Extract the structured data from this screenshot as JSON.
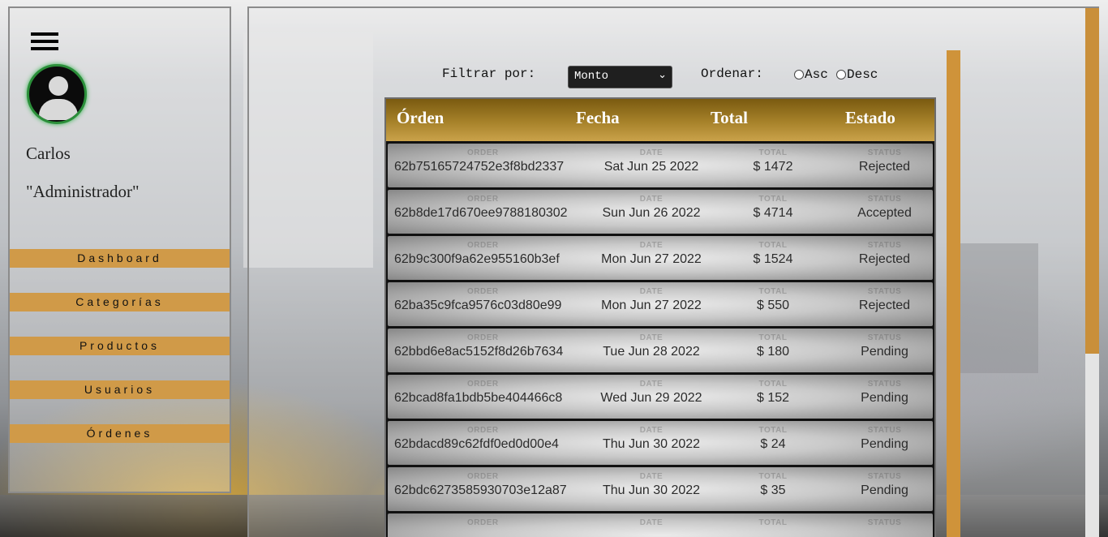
{
  "sidebar": {
    "user_name": "Carlos",
    "user_role": "\"Administrador\"",
    "nav": [
      "Dashboard",
      "Categorías",
      "Productos",
      "Usuarios",
      "Órdenes"
    ]
  },
  "filters": {
    "filter_label": "Filtrar por:",
    "filter_value": "Monto",
    "order_label": "Ordenar:",
    "asc_label": "Asc",
    "desc_label": "Desc"
  },
  "table": {
    "headers": [
      "Órden",
      "Fecha",
      "Total",
      "Estado"
    ],
    "cell_tags": [
      "ORDER",
      "DATE",
      "TOTAL",
      "STATUS"
    ],
    "rows": [
      {
        "order": "62b75165724752e3f8bd2337",
        "date": "Sat Jun 25 2022",
        "total": "$ 1472",
        "status": "Rejected"
      },
      {
        "order": "62b8de17d670ee9788180302",
        "date": "Sun Jun 26 2022",
        "total": "$ 4714",
        "status": "Accepted"
      },
      {
        "order": "62b9c300f9a62e955160b3ef",
        "date": "Mon Jun 27 2022",
        "total": "$ 1524",
        "status": "Rejected"
      },
      {
        "order": "62ba35c9fca9576c03d80e99",
        "date": "Mon Jun 27 2022",
        "total": "$ 550",
        "status": "Rejected"
      },
      {
        "order": "62bbd6e8ac5152f8d26b7634",
        "date": "Tue Jun 28 2022",
        "total": "$ 180",
        "status": "Pending"
      },
      {
        "order": "62bcad8fa1bdb5be404466c8",
        "date": "Wed Jun 29 2022",
        "total": "$ 152",
        "status": "Pending"
      },
      {
        "order": "62bdacd89c62fdf0ed0d00e4",
        "date": "Thu Jun 30 2022",
        "total": "$ 24",
        "status": "Pending"
      },
      {
        "order": "62bdc6273585930703e12a87",
        "date": "Thu Jun 30 2022",
        "total": "$ 35",
        "status": "Pending"
      },
      {
        "order": "",
        "date": "",
        "total": "",
        "status": ""
      }
    ]
  },
  "colors": {
    "accent": "#d09a48",
    "header_gold": "#a7822a",
    "avatar_ring": "#2b8f3a"
  }
}
